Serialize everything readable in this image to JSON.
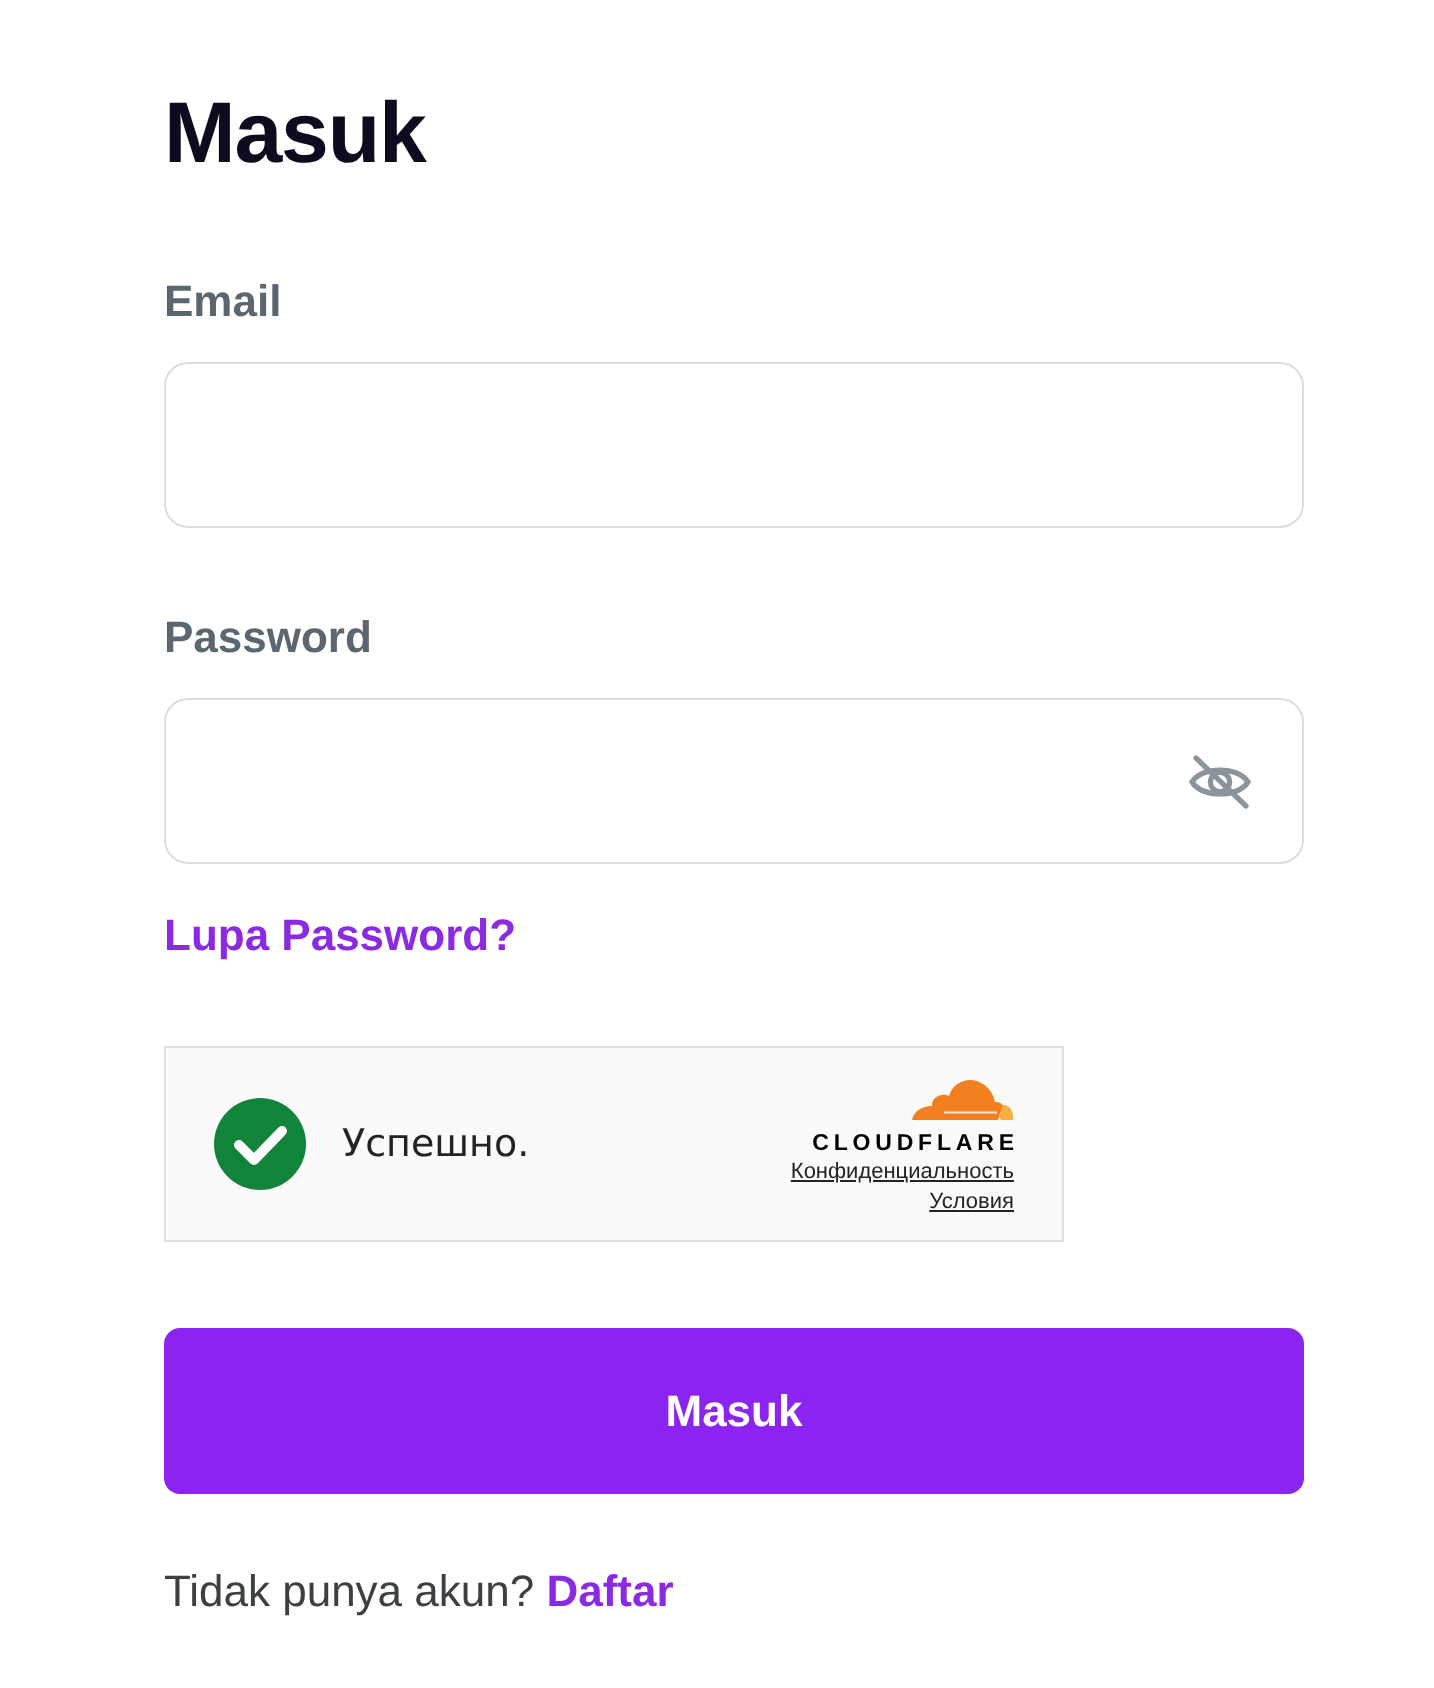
{
  "title": "Masuk",
  "fields": [
    {
      "label": "Email",
      "kind": "text"
    },
    {
      "label": "Password",
      "kind": "password",
      "show_password": false
    }
  ],
  "forgot_link": "Lupa Password?",
  "captcha": {
    "verified": true,
    "status": "Успешно.",
    "brand": "CLOUDFLARE",
    "links": [
      "Конфиденциальность",
      "Условия"
    ]
  },
  "submit": "Masuk",
  "footer": {
    "text": "Tidak punya akun?",
    "link": "Daftar"
  }
}
